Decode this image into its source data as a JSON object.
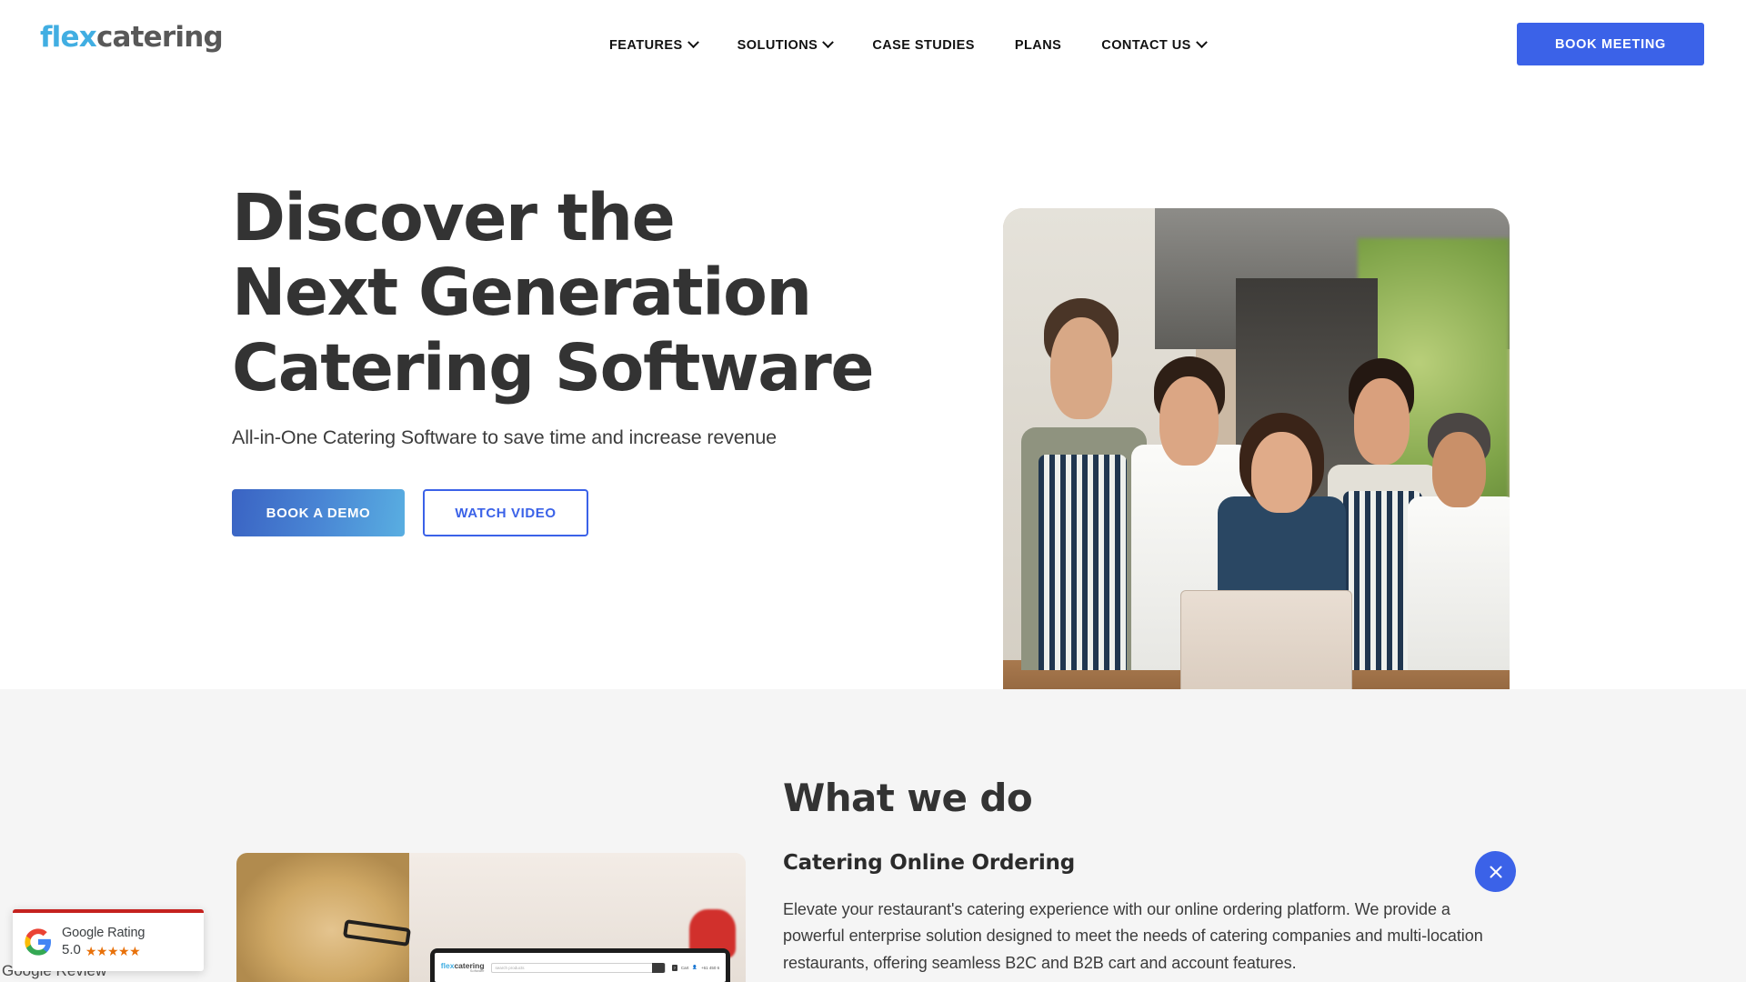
{
  "header": {
    "logo": {
      "part1": "flex",
      "part2": "catering",
      "color1": "#41AEE2",
      "color2": "#585858"
    },
    "nav": [
      {
        "label": "FEATURES",
        "has_dropdown": true,
        "icon": "chevron-down-icon"
      },
      {
        "label": "SOLUTIONS",
        "has_dropdown": true,
        "icon": "chevron-down-icon"
      },
      {
        "label": "CASE STUDIES",
        "has_dropdown": false
      },
      {
        "label": "PLANS",
        "has_dropdown": false
      },
      {
        "label": "CONTACT US",
        "has_dropdown": true,
        "icon": "chevron-down-icon"
      }
    ],
    "cta": {
      "label": "BOOK MEETING",
      "bg": "#3B62E8",
      "color": "#FFFFFF"
    }
  },
  "hero": {
    "title_line1": "Discover the",
    "title_line2": "Next Generation",
    "title_line3": "Catering Software",
    "subtitle": "All-in-One Catering Software to save time and increase revenue",
    "primary_button": {
      "label": "BOOK A DEMO",
      "gradient_from": "#3A63C3",
      "gradient_to": "#59AEE1"
    },
    "secondary_button": {
      "label": "WATCH VIDEO",
      "border": "#3B62E8",
      "color": "#3B62E8"
    },
    "image_alt": "Five restaurant staff in aprons and chef coats gathered around a laptop"
  },
  "what_we_do": {
    "section_title": "What we do",
    "section_bg": "#F5F5F5",
    "accordion": {
      "title": "Catering Online Ordering",
      "body": "Elevate your restaurant's catering experience with our online ordering platform. We provide a powerful enterprise solution designed to meet the needs of catering companies and multi-location restaurants, offering seamless B2C and B2B cart and account features.",
      "toggle_icon": "close-icon",
      "toggle_bg": "#3B62E8"
    },
    "feature_image": {
      "alt": "Blonde woman with glasses viewing a laptop showing the flexcatering ordering screen",
      "screen": {
        "logo1": "flex",
        "logo2": "catering",
        "logo_sub": "Software",
        "search_placeholder": "search products",
        "search_icon": "search-icon",
        "cart_label": "Cart",
        "account_icon": "user-icon",
        "phone": "+61 450 6"
      }
    }
  },
  "google_widget": {
    "logo": "google-g-icon",
    "label": "Google Rating",
    "score": "5.0",
    "stars": "★★★★★",
    "star_count": 5,
    "star_color": "#E8710A",
    "accent_bar": "#C5221F",
    "behind_text": "Google Review"
  }
}
